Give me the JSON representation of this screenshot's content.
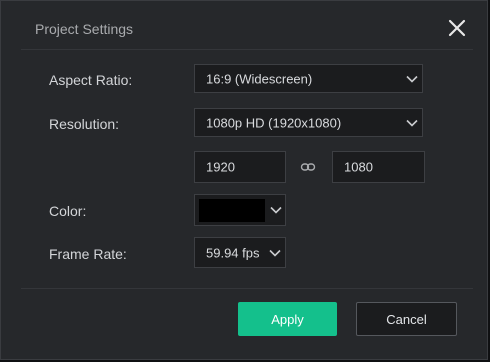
{
  "dialog": {
    "title": "Project Settings",
    "close_icon": "close-icon"
  },
  "form": {
    "aspect_ratio": {
      "label": "Aspect Ratio:",
      "value": "16:9 (Widescreen)"
    },
    "resolution": {
      "label": "Resolution:",
      "value": "1080p HD (1920x1080)",
      "width": "1920",
      "height": "1080",
      "link_icon": "link-icon"
    },
    "color": {
      "label": "Color:",
      "value": "#000000"
    },
    "frame_rate": {
      "label": "Frame Rate:",
      "value": "59.94 fps"
    }
  },
  "buttons": {
    "apply": "Apply",
    "cancel": "Cancel"
  },
  "colors": {
    "accent": "#14c08c",
    "dialog_bg": "#26282b",
    "field_bg": "#1b1c1e"
  }
}
